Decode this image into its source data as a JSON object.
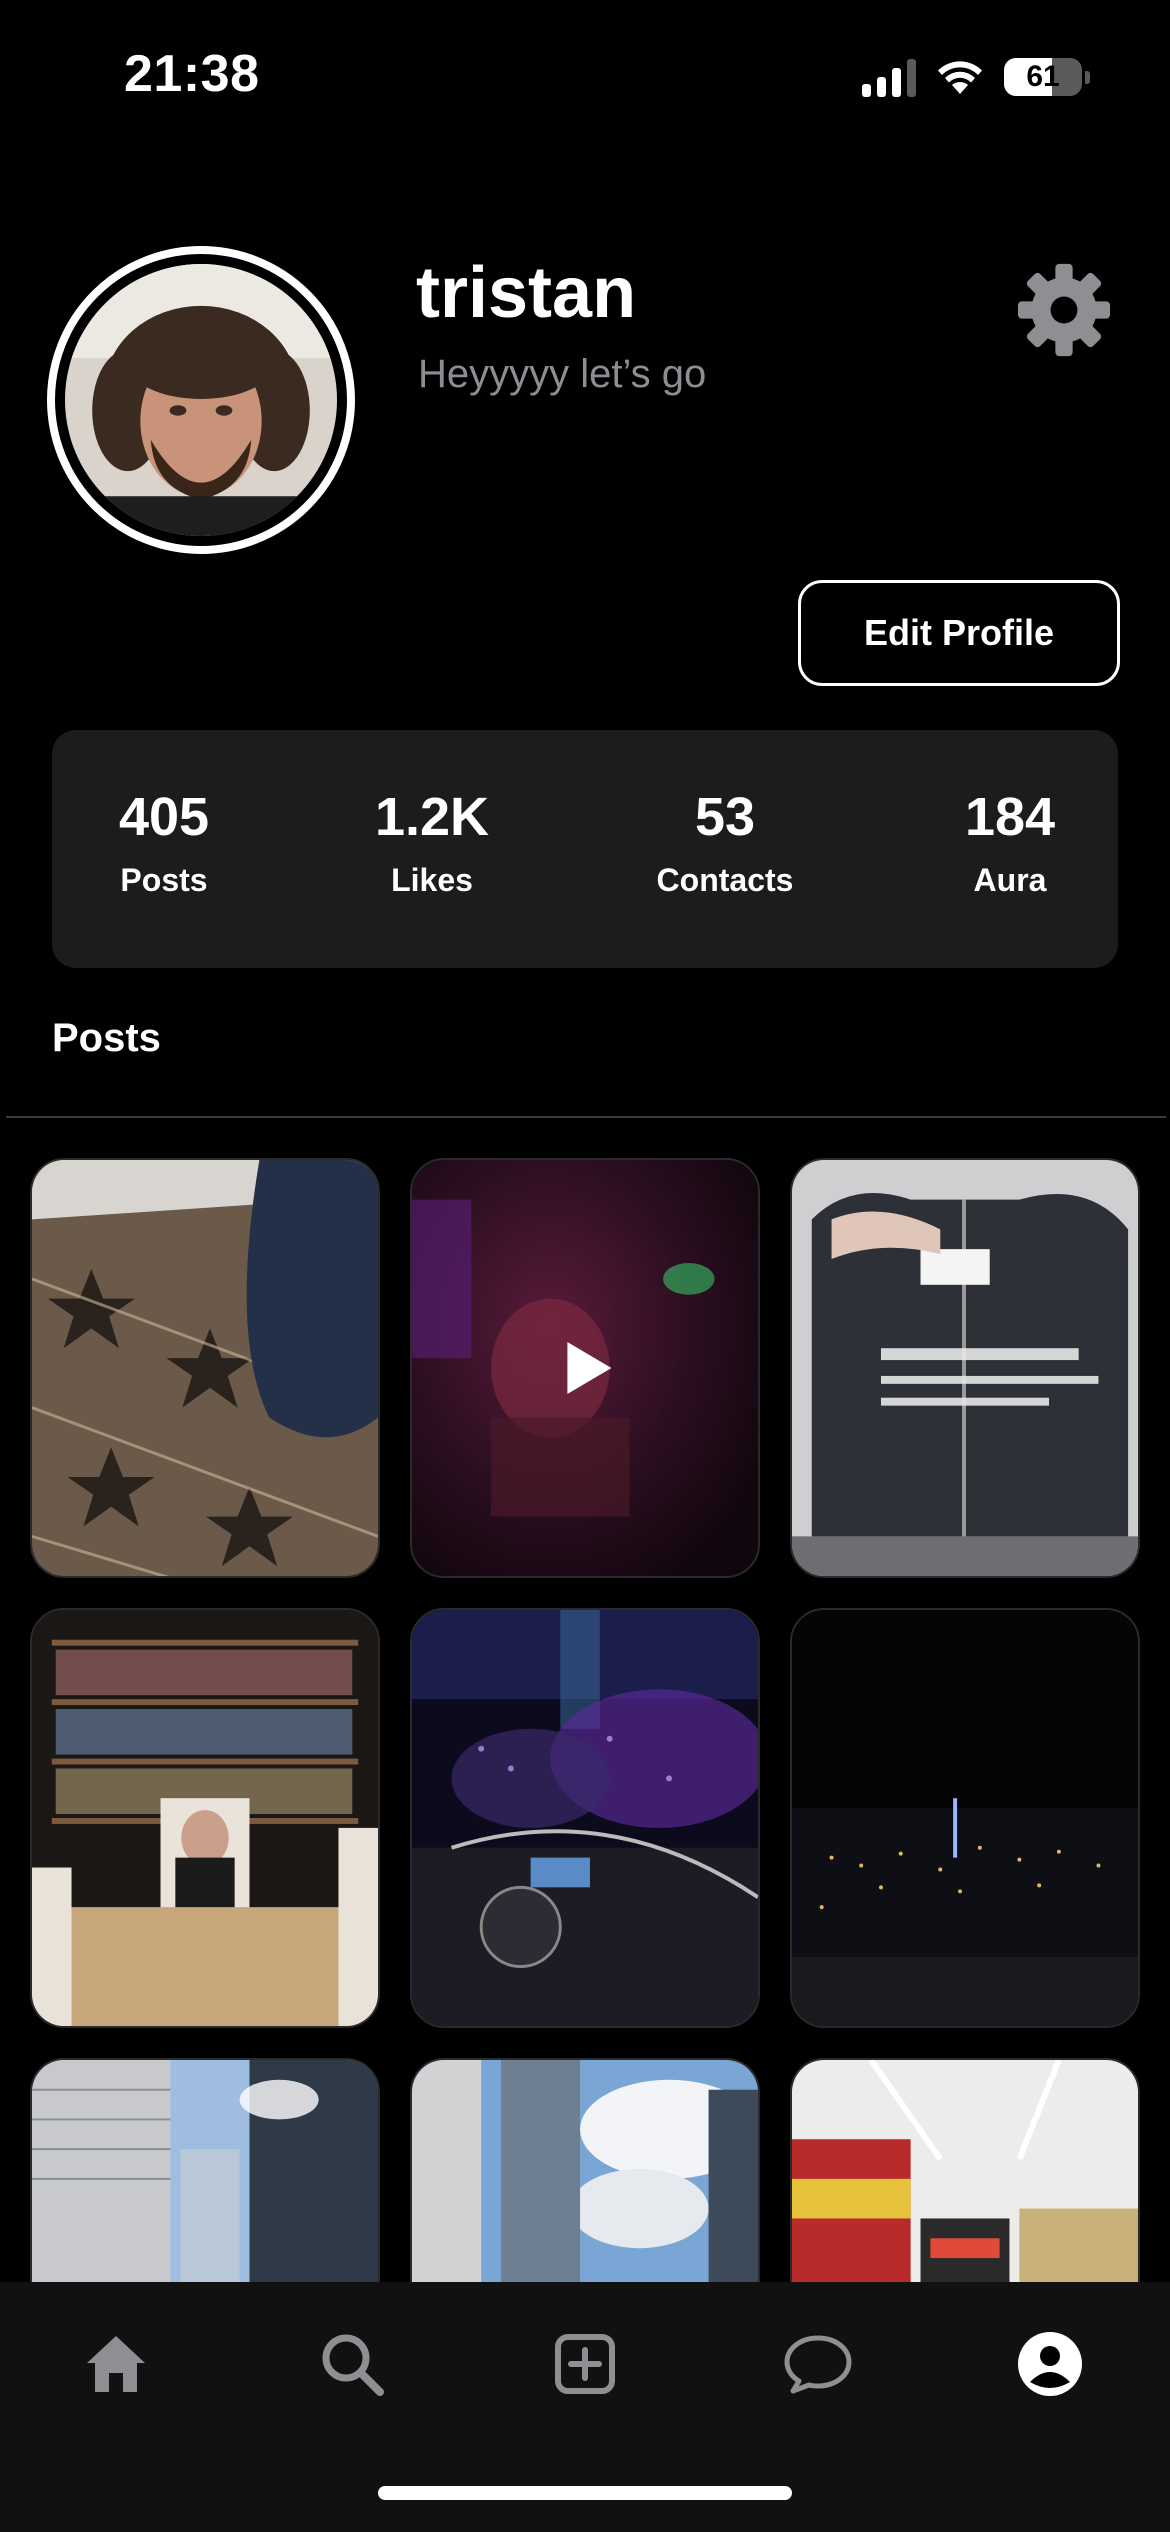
{
  "status_bar": {
    "time": "21:38",
    "battery_percent": "61",
    "battery_level": 0.61
  },
  "profile": {
    "username": "tristan",
    "bio": "Heyyyyy let’s go",
    "edit_button_label": "Edit Profile"
  },
  "stats": [
    {
      "value": "405",
      "label": "Posts"
    },
    {
      "value": "1.2K",
      "label": "Likes"
    },
    {
      "value": "53",
      "label": "Contacts"
    },
    {
      "value": "184",
      "label": "Aura"
    }
  ],
  "posts_section": {
    "title": "Posts",
    "items": [
      {
        "kind": "photo",
        "subject": "patterned-tile-floor"
      },
      {
        "kind": "video",
        "subject": "dark-club-scene"
      },
      {
        "kind": "photo",
        "subject": "black-hoodie-with-text"
      },
      {
        "kind": "photo",
        "subject": "library-meeting-room"
      },
      {
        "kind": "photo",
        "subject": "dj-booth-purple-lights"
      },
      {
        "kind": "photo",
        "subject": "night-city-skyline"
      },
      {
        "kind": "photo",
        "subject": "skyscrapers"
      },
      {
        "kind": "photo",
        "subject": "tower-and-clouds"
      },
      {
        "kind": "photo",
        "subject": "store-aisle"
      }
    ]
  },
  "tab_bar": {
    "items": [
      {
        "icon": "home-icon"
      },
      {
        "icon": "search-icon"
      },
      {
        "icon": "plus-square-icon"
      },
      {
        "icon": "chat-bubble-icon"
      },
      {
        "icon": "profile-icon"
      }
    ],
    "active": "profile-icon"
  },
  "colors": {
    "background": "#000000",
    "card": "#1c1c1e",
    "muted_text": "#8d8d93",
    "icon_gray": "#8e8e93"
  }
}
